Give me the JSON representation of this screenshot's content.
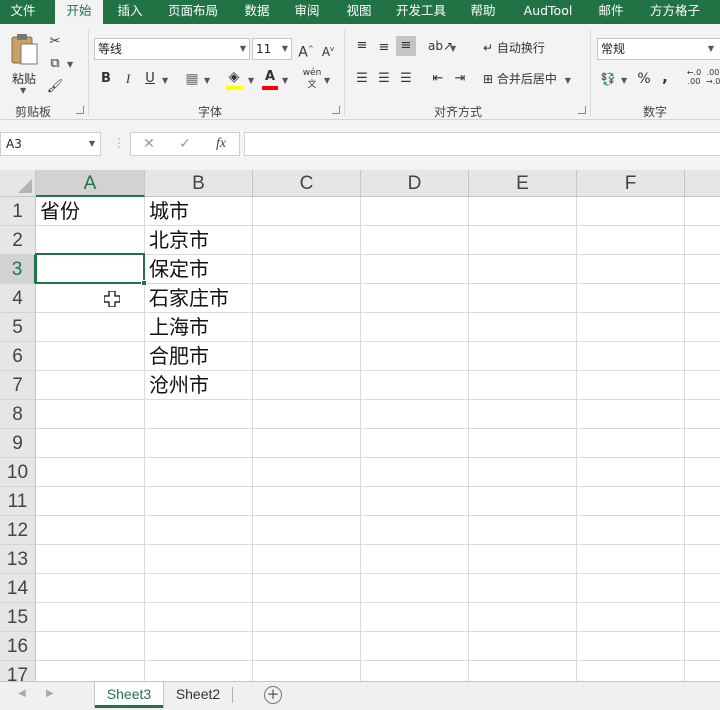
{
  "menu": {
    "tabs": [
      {
        "label": "文件"
      },
      {
        "label": "开始"
      },
      {
        "label": "插入"
      },
      {
        "label": "页面布局"
      },
      {
        "label": "数据"
      },
      {
        "label": "审阅"
      },
      {
        "label": "视图"
      },
      {
        "label": "开发工具"
      },
      {
        "label": "帮助"
      },
      {
        "label": "AudTool"
      },
      {
        "label": "邮件"
      },
      {
        "label": "方方格子"
      }
    ],
    "active_tab": "开始"
  },
  "ribbon": {
    "clipboard": {
      "label": "剪贴板",
      "paste_label": "粘贴"
    },
    "font": {
      "label": "字体",
      "font_name": "等线",
      "font_size": "11",
      "bold": "B",
      "italic": "I",
      "underline": "U",
      "grow": "A",
      "shrink": "A",
      "font_color_glyph": "A",
      "phonetic": "wén"
    },
    "alignment": {
      "label": "对齐方式",
      "wrap_text": "自动换行",
      "merge_center": "合并后居中"
    },
    "number": {
      "label": "数字",
      "format": "常规",
      "percent": "%",
      "comma": ",",
      "increase_decimal": "←.0\n.00",
      "decrease_decimal": ".00\n→.0"
    }
  },
  "formula_bar": {
    "name_box": "A3",
    "fx_label": "fx",
    "formula": ""
  },
  "sheet": {
    "columns": [
      "A",
      "B",
      "C",
      "D",
      "E",
      "F"
    ],
    "rows": [
      "1",
      "2",
      "3",
      "4",
      "5",
      "6",
      "7",
      "8",
      "9",
      "10",
      "11",
      "12",
      "13",
      "14",
      "15",
      "16",
      "17"
    ],
    "selected_cell": "A3",
    "cells": {
      "A1": "省份",
      "B1": "城市",
      "B2": "北京市",
      "B3": "保定市",
      "B4": "石家庄市",
      "B5": "上海市",
      "B6": "合肥市",
      "B7": "沧州市"
    }
  },
  "sheet_tabs": {
    "tabs": [
      {
        "label": "Sheet3"
      },
      {
        "label": "Sheet2"
      }
    ],
    "active": "Sheet3",
    "add_symbol": "+"
  },
  "colors": {
    "accent": "#217346",
    "ribbon_bg": "#f3f3f3",
    "header_bg": "#e6e6e6",
    "fill_highlight": "#ffff00",
    "font_color": "#ff0000"
  }
}
